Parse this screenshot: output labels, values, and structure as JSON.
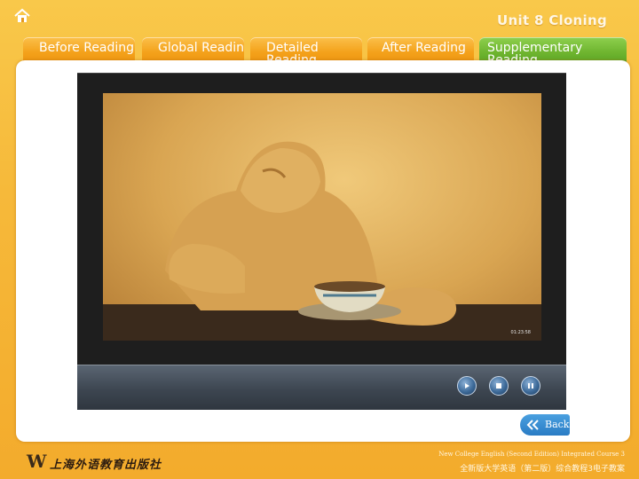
{
  "header": {
    "home_icon": "home-icon",
    "unit_title": "Unit 8 Cloning"
  },
  "tabs": [
    {
      "label": "Before Reading",
      "active": false
    },
    {
      "label": "Global Reading",
      "active": false
    },
    {
      "label": "Detailed Reading",
      "active": false
    },
    {
      "label": "After Reading",
      "active": false
    },
    {
      "label": "Supplementary Reading",
      "active": true
    }
  ],
  "player": {
    "video_stamp": "01:23:58",
    "controls": [
      "play-icon",
      "stop-icon",
      "pause-icon"
    ]
  },
  "back_button": {
    "label": "Back",
    "icon": "double-chevron-left-icon"
  },
  "footer": {
    "publisher": "上海外语教育出版社",
    "course_en": "New College English (Second Edition) Integrated Course 3",
    "course_cn": "全新版大学英语（第二版）综合教程3电子教案"
  },
  "colors": {
    "tab": "#f4a21b",
    "active_tab": "#6fb530",
    "accent": "#2a7cc4",
    "background": "#f6b93a"
  }
}
